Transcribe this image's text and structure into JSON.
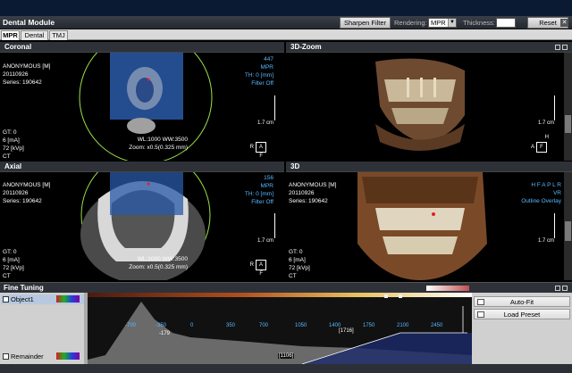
{
  "window": {
    "title": "Dental Module"
  },
  "toolbar": {
    "sharpen_label": "Sharpen Filter",
    "rendering_label": "Rendering:",
    "rendering_value": "MPR",
    "thickness_label": "Thickness:",
    "thickness_value": "",
    "reset_label": "Reset"
  },
  "tabs": [
    {
      "label": "MPR"
    },
    {
      "label": "Dental"
    },
    {
      "label": "TMJ"
    }
  ],
  "panes": {
    "coronal": {
      "title": "Coronal",
      "patient": [
        "ANONYMOUS [M]",
        "20110926",
        "Series: 190642"
      ],
      "top_right": [
        "447",
        "MPR",
        "TH: 0 [mm]",
        "Filter Off"
      ],
      "bottom_left": [
        "GT: 0",
        "6 [mA]",
        "72 [kVp]",
        "CT"
      ],
      "wl": "WL:1000 WW:3500",
      "zoom": "Zoom: x0.5(0.325 mm)",
      "scale": "1.7 cm",
      "orient": "A",
      "orient_l": "R",
      "orient_b": "F"
    },
    "zoom3d": {
      "title": "3D-Zoom",
      "scale": "1.7 cm",
      "orient": "F",
      "orient_t": "H",
      "orient_l": "A"
    },
    "axial": {
      "title": "Axial",
      "patient": [
        "ANONYMOUS [M]",
        "20110926",
        "Series: 190642"
      ],
      "top_right": [
        "156",
        "MPR",
        "TH: 0 [mm]",
        "Filter Off"
      ],
      "bottom_left": [
        "GT: 0",
        "6 [mA]",
        "72 [kVp]",
        "CT"
      ],
      "wl": "WL:1000 WW:3500",
      "zoom": "Zoom: x0.5(0.325 mm)",
      "scale": "1.7 cm",
      "orient": "A",
      "orient_l": "R",
      "orient_b": "F"
    },
    "view3d": {
      "title": "3D",
      "patient": [
        "ANONYMOUS [M]",
        "20110926",
        "Series: 190642"
      ],
      "top_right": [
        "H F A P L R",
        "VR",
        "Outline Overlay"
      ],
      "bottom_left": [
        "GT: 0",
        "6 [mA]",
        "72 [kVp]",
        "CT"
      ],
      "scale": "1.7 cm"
    }
  },
  "fine_tuning": {
    "title": "Fine Tuning",
    "objects": [
      {
        "label": "Object1"
      },
      {
        "label": "Remainder"
      }
    ],
    "ticks": [
      "-700",
      "-350",
      "0",
      "350",
      "700",
      "1050",
      "1400",
      "1750",
      "2100",
      "2450"
    ],
    "marker_value": "-179",
    "mid_label": "[1716]",
    "bottom_label": "[1106]",
    "autofit_label": "Auto-Fit",
    "load_preset_label": "Load Preset"
  },
  "colors": {
    "accent_blue": "#5ab8ff",
    "ring_green": "#9ee04a",
    "title_bar": "#2e3238"
  }
}
